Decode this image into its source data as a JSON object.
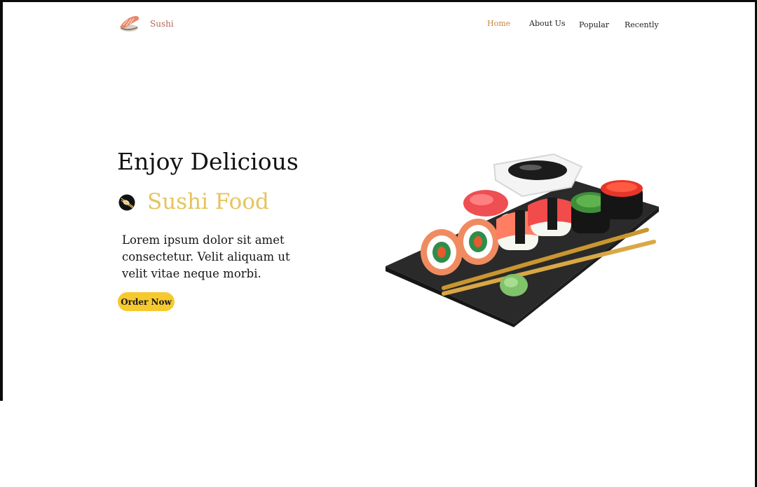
{
  "header": {
    "brand_name": "Sushi",
    "logo_icon": "sushi-nigiri-icon",
    "nav": {
      "home": "Home",
      "about": "About Us",
      "popular": "Popular",
      "recently": "Recently"
    },
    "active_nav": "home"
  },
  "hero": {
    "title": "Enjoy Delicious",
    "subtitle": "Sushi Food",
    "subtitle_icon": "chopsticks-icon",
    "description": "Lorem ipsum dolor sit amet consectetur. Velit aliquam ut velit vitae neque morbi.",
    "cta_label": "Order Now",
    "illustration": "sushi-platter-image"
  },
  "colors": {
    "accent_gold": "#e6c35c",
    "button_yellow": "#f6c92f",
    "active_nav": "#c9853f",
    "brand_text": "#b0665a",
    "text_dark": "#121212"
  }
}
